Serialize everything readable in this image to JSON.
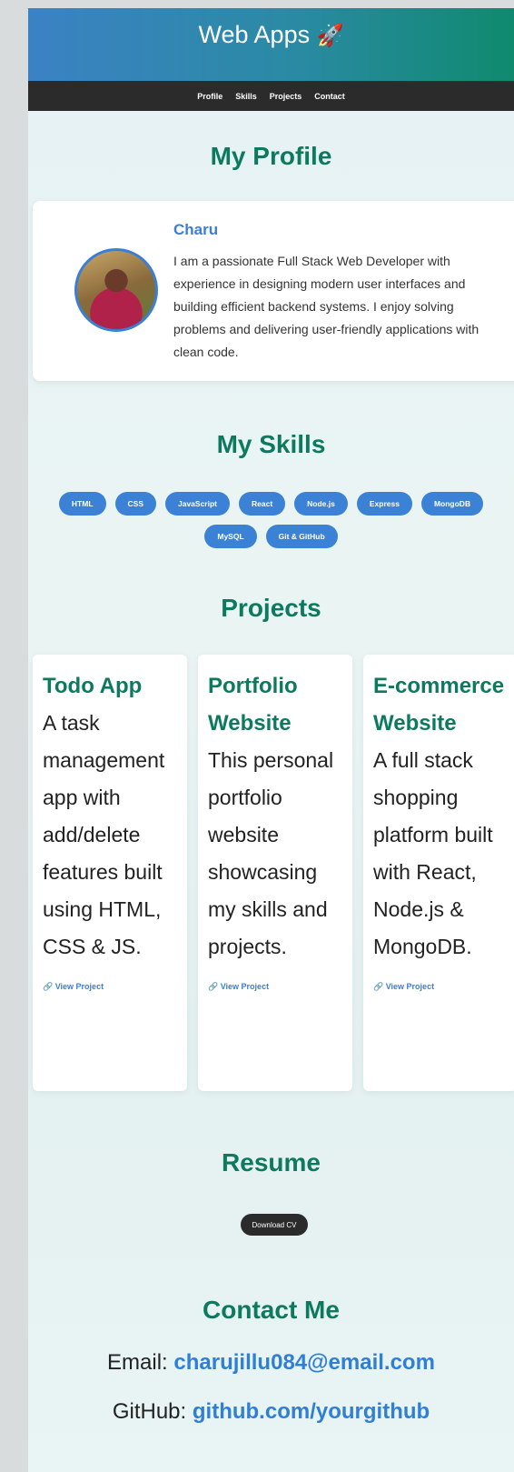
{
  "header": {
    "title": "Web Apps",
    "emoji": "🚀"
  },
  "nav": {
    "items": [
      "Profile",
      "Skills",
      "Projects",
      "Contact"
    ]
  },
  "profile": {
    "heading": "My Profile",
    "name": "Charu",
    "bio": "I am a passionate Full Stack Web Developer with experience in designing modern user interfaces and building efficient backend systems. I enjoy solving problems and delivering user-friendly applications with clean code."
  },
  "skills": {
    "heading": "My Skills",
    "items": [
      "HTML",
      "CSS",
      "JavaScript",
      "React",
      "Node.js",
      "Express",
      "MongoDB",
      "MySQL",
      "Git & GitHub"
    ]
  },
  "projects": {
    "heading": "Projects",
    "items": [
      {
        "title": "Todo App",
        "desc": "A task management app with add/delete features built using HTML, CSS & JS.",
        "link": "🔗 View Project"
      },
      {
        "title": "Portfolio Website",
        "desc": "This personal portfolio website showcasing my skills and projects.",
        "link": "🔗 View Project"
      },
      {
        "title": "E-commerce Website",
        "desc": "A full stack shopping platform built with React, Node.js & MongoDB.",
        "link": "🔗 View Project"
      }
    ]
  },
  "resume": {
    "heading": "Resume",
    "button": "Download CV"
  },
  "contact": {
    "heading": "Contact Me",
    "email_label": "Email:",
    "email": "charujillu084@email.com",
    "github_label": "GitHub:",
    "github": "github.com/yourgithub"
  },
  "colors": {
    "accent": "#0d7a5f",
    "link": "#3b7fd4",
    "pill": "#3b82d6",
    "nav": "#2b2b2b"
  }
}
